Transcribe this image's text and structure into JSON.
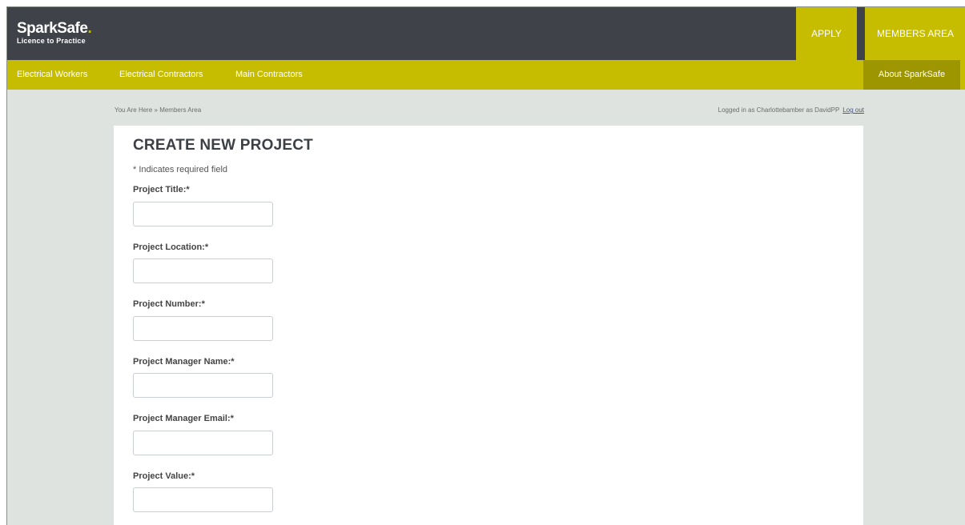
{
  "brand": {
    "name": "SparkSafe",
    "dot": ".",
    "tagline": "Licence to Practice"
  },
  "header": {
    "apply_label": "APPLY",
    "members_label": "MEMBERS AREA"
  },
  "nav": {
    "items": [
      {
        "label": "Electrical Workers"
      },
      {
        "label": "Electrical Contractors"
      },
      {
        "label": "Main Contractors"
      }
    ],
    "about_label": "About SparkSafe"
  },
  "breadcrumb": "You Are Here » Members Area",
  "session": {
    "logged_in_text": "Logged in as Charlottebamber as DavidPP",
    "logout_label": "Log out"
  },
  "form": {
    "title": "CREATE NEW PROJECT",
    "required_note": "* Indicates required field",
    "fields": [
      {
        "label": "Project Title:*",
        "value": "",
        "placeholder": ""
      },
      {
        "label": "Project Location:*",
        "value": "",
        "placeholder": ""
      },
      {
        "label": "Project Number:*",
        "value": "",
        "placeholder": ""
      },
      {
        "label": "Project Manager Name:*",
        "value": "",
        "placeholder": ""
      },
      {
        "label": "Project Manager Email:*",
        "value": "",
        "placeholder": ""
      },
      {
        "label": "Project Value:*",
        "value": "",
        "placeholder": ""
      }
    ]
  },
  "colors": {
    "accent": "#c6bd00",
    "accent_dark": "#9d9600",
    "header_bg": "#3f4248",
    "page_bg": "#dfe3df"
  }
}
